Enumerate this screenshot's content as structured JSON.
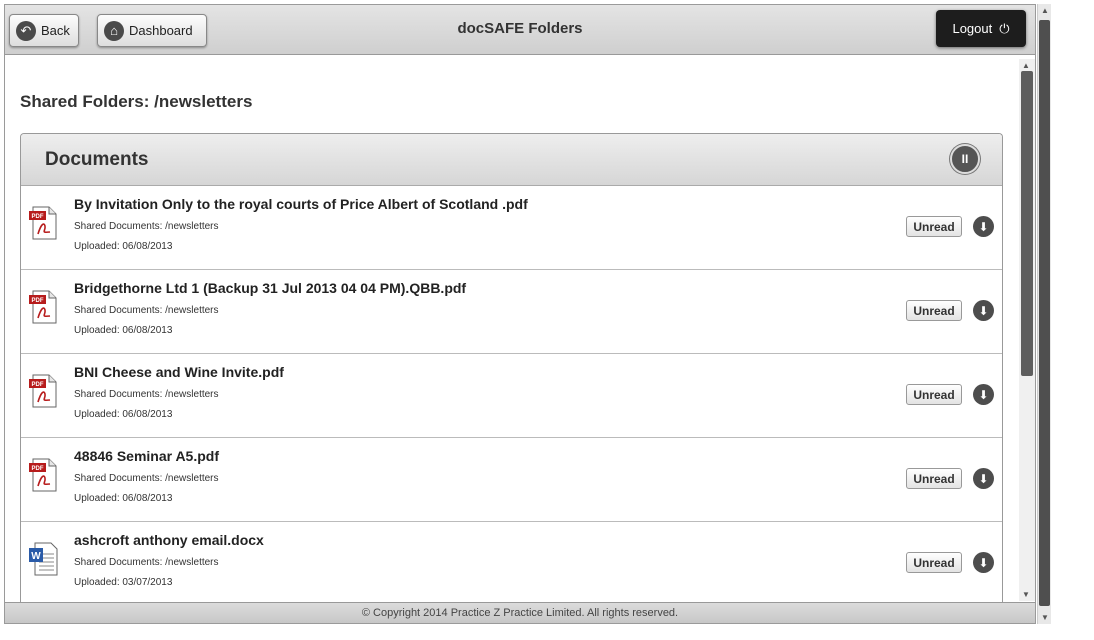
{
  "header": {
    "back_label": "Back",
    "dashboard_label": "Dashboard",
    "title": "docSAFE Folders",
    "logout_label": "Logout"
  },
  "page_heading": "Shared Folders: /newsletters",
  "panel": {
    "title": "Documents"
  },
  "documents": [
    {
      "name": "By Invitation Only to the royal courts of Price Albert of Scotland .pdf",
      "folder": "Shared Documents: /newsletters",
      "uploaded": "Uploaded: 06/08/2013",
      "status": "Unread",
      "icon": "pdf-file-icon"
    },
    {
      "name": "Bridgethorne Ltd 1 (Backup 31 Jul 2013 04 04 PM).QBB.pdf",
      "folder": "Shared Documents: /newsletters",
      "uploaded": "Uploaded: 06/08/2013",
      "status": "Unread",
      "icon": "pdf-file-icon"
    },
    {
      "name": "BNI Cheese and Wine Invite.pdf",
      "folder": "Shared Documents: /newsletters",
      "uploaded": "Uploaded: 06/08/2013",
      "status": "Unread",
      "icon": "pdf-file-icon"
    },
    {
      "name": "48846 Seminar A5.pdf",
      "folder": "Shared Documents: /newsletters",
      "uploaded": "Uploaded: 06/08/2013",
      "status": "Unread",
      "icon": "pdf-file-icon"
    },
    {
      "name": "ashcroft anthony email.docx",
      "folder": "Shared Documents: /newsletters",
      "uploaded": "Uploaded: 03/07/2013",
      "status": "Unread",
      "icon": "word-file-icon"
    }
  ],
  "footer": {
    "copyright": "© Copyright 2014 Practice Z Practice Limited. All rights reserved."
  }
}
